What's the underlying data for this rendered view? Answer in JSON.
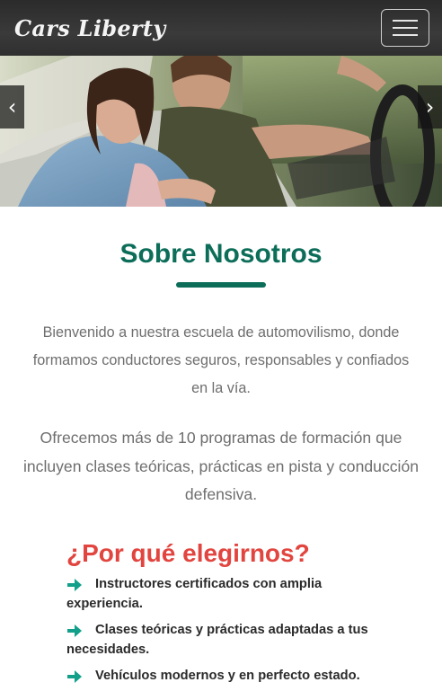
{
  "navbar": {
    "brand": "Cars Liberty",
    "menu_icon": "hamburger-icon"
  },
  "carousel": {
    "prev_icon": "chevron-left-icon",
    "next_icon": "chevron-right-icon",
    "prev_glyph": "‹",
    "next_glyph": "›"
  },
  "about": {
    "title": "Sobre Nosotros",
    "paragraph_1": "Bienvenido a nuestra escuela de automovilismo, donde formamos conductores seguros, responsables y confiados en la vía.",
    "paragraph_2": "Ofrecemos más de 10 programas de formación que incluyen clases teóricas, prácticas en pista y conducción defensiva."
  },
  "why": {
    "title": "¿Por qué elegirnos?",
    "items": [
      "Instructores certificados con amplia experiencia.",
      "Clases teóricas y prácticas adaptadas a tus necesidades.",
      "Vehículos modernos y en perfecto estado."
    ],
    "bullet_icon": "arrow-right-icon"
  },
  "colors": {
    "accent_green": "#0c6d59",
    "accent_red": "#e2453f",
    "bullet_teal": "#12a08a",
    "navbar_bg": "#333333"
  }
}
